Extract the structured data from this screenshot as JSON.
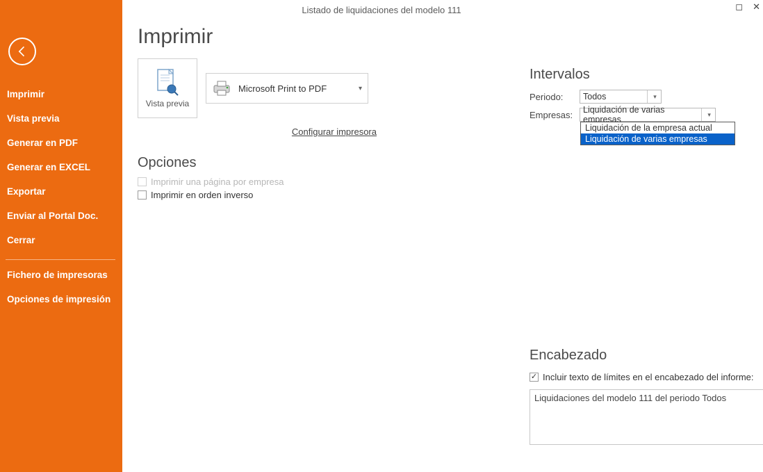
{
  "window": {
    "title": "Listado de liquidaciones del modelo 111"
  },
  "sidebar": {
    "items": [
      "Imprimir",
      "Vista previa",
      "Generar en PDF",
      "Generar en EXCEL",
      "Exportar",
      "Enviar al Portal Doc.",
      "Cerrar"
    ],
    "secondary": [
      "Fichero de impresoras",
      "Opciones de impresión"
    ]
  },
  "page": {
    "title": "Imprimir",
    "preview_label": "Vista previa",
    "printer_name": "Microsoft Print to PDF",
    "config_printer": "Configurar impresora"
  },
  "options": {
    "title": "Opciones",
    "one_per_company": {
      "label": "Imprimir una página por empresa",
      "checked": false,
      "disabled": true
    },
    "reverse_order": {
      "label": "Imprimir en orden inverso",
      "checked": false,
      "disabled": false
    }
  },
  "intervals": {
    "title": "Intervalos",
    "period_label": "Periodo:",
    "period_value": "Todos",
    "companies_label": "Empresas:",
    "companies_value": "Liquidación de varias empresas",
    "companies_options": [
      "Liquidación de la empresa actual",
      "Liquidación de varias empresas"
    ],
    "companies_selected_index": 1
  },
  "header": {
    "title": "Encabezado",
    "include_limits_label": "Incluir texto de límites en el encabezado del informe:",
    "include_limits_checked": true,
    "text": "Liquidaciones del modelo 111 del periodo Todos"
  }
}
